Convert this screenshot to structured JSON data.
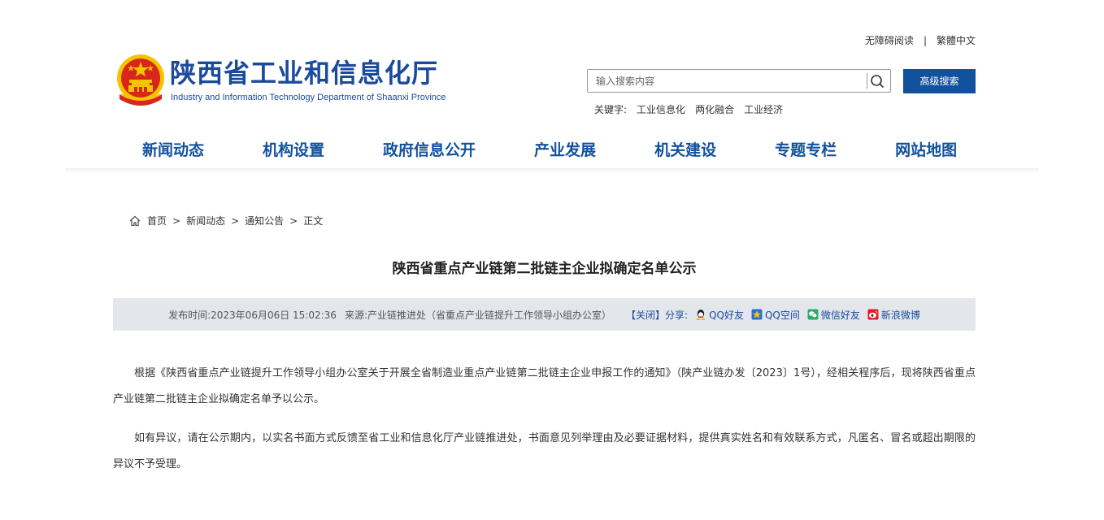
{
  "top_links": {
    "accessibility": "无障碍阅读",
    "separator": "|",
    "traditional": "繁體中文"
  },
  "logo": {
    "title": "陕西省工业和信息化厅",
    "subtitle": "Industry and Information Technology Department of Shaanxi Province"
  },
  "search": {
    "placeholder": "输入搜索内容",
    "button_icon": "search-icon",
    "advanced_label": "高级搜索"
  },
  "keywords": {
    "label": "关键字:",
    "items": [
      "工业信息化",
      "两化融合",
      "工业经济"
    ]
  },
  "nav": {
    "items": [
      "新闻动态",
      "机构设置",
      "政府信息公开",
      "产业发展",
      "机关建设",
      "专题专栏",
      "网站地图"
    ]
  },
  "breadcrumb": {
    "items": [
      "首页",
      "新闻动态",
      "通知公告",
      "正文"
    ],
    "separator": ">"
  },
  "article": {
    "title": "陕西省重点产业链第二批链主企业拟确定名单公示",
    "meta": {
      "publish_label": "发布时间:",
      "publish_time": "2023年06月06日 15:02:36",
      "source_label": "来源:",
      "source": "产业链推进处（省重点产业链提升工作领导小组办公室）",
      "close_label": "【关闭】",
      "share_label": "分享:",
      "share": [
        {
          "label": "QQ好友",
          "icon": "qq-icon",
          "color": "#2b6fd6"
        },
        {
          "label": "QQ空间",
          "icon": "qzone-icon",
          "color": "#f5b400"
        },
        {
          "label": "微信好友",
          "icon": "wechat-icon",
          "color": "#2aae67"
        },
        {
          "label": "新浪微博",
          "icon": "weibo-icon",
          "color": "#e6162d"
        }
      ]
    },
    "paragraphs": [
      "根据《陕西省重点产业链提升工作领导小组办公室关于开展全省制造业重点产业链第二批链主企业申报工作的通知》（陕产业链办发〔2023〕1号），经相关程序后，现将陕西省重点产业链第二批链主企业拟确定名单予以公示。",
      "如有异议，请在公示期内，以实名书面方式反馈至省工业和信息化厅产业链推进处，书面意见列举理由及必要证据材料，提供真实姓名和有效联系方式，凡匿名、冒名或超出期限的异议不予受理。"
    ]
  },
  "colors": {
    "brand": "#12529d",
    "title_blue": "#1a4a9c",
    "meta_bg": "#e3e7ec",
    "emblem_red": "#d9261c",
    "emblem_gold": "#f5c400"
  }
}
